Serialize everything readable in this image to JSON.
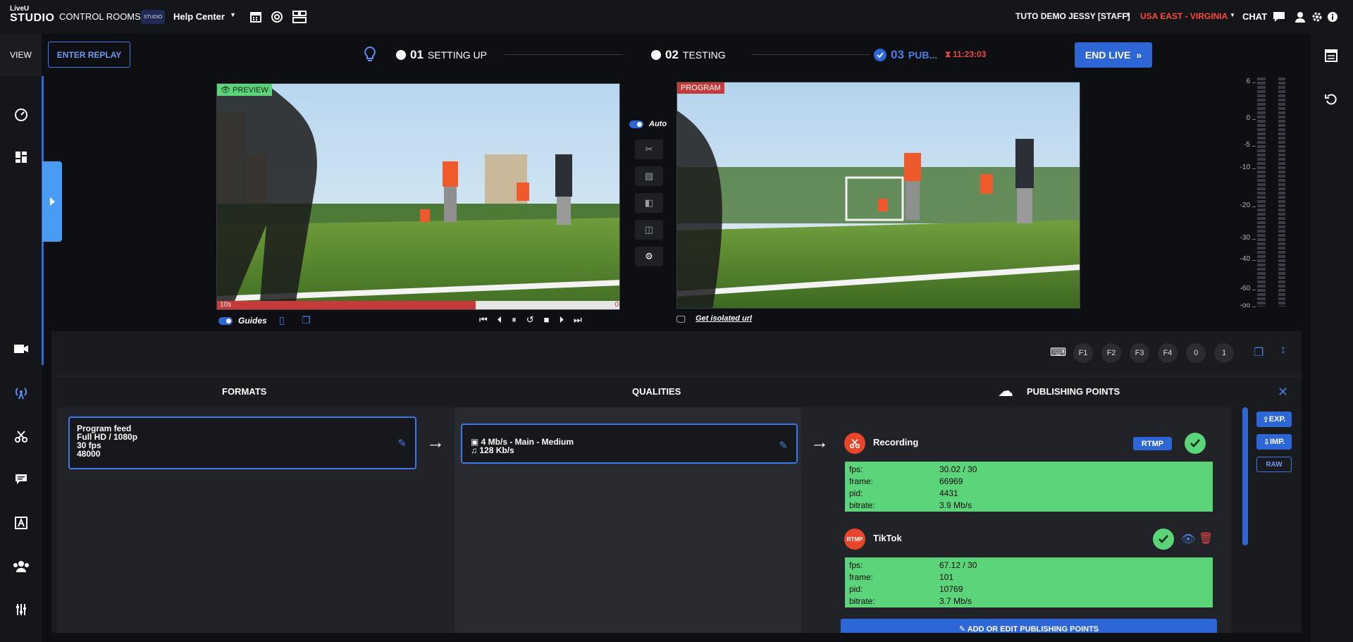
{
  "topbar": {
    "logo_line1": "LiveU",
    "logo_line2": "STUDIO",
    "control_rooms": "CONTROL ROOMS",
    "help_thumb": "STUDIO",
    "help_center": "Help Center",
    "user": "TUTO DEMO JESSY [STAFF]",
    "region": "USA EAST - VIRGINIA",
    "chat": "CHAT"
  },
  "sidebar": {
    "view_label": "VIEW"
  },
  "header": {
    "enter_replay": "ENTER REPLAY",
    "steps": [
      {
        "num": "01",
        "label": "SETTING UP"
      },
      {
        "num": "02",
        "label": "TESTING"
      },
      {
        "num": "03",
        "label": "PUB..."
      }
    ],
    "timer": "11:23:03",
    "end_live": "END LIVE"
  },
  "preview": {
    "label": "PREVIEW",
    "replay_time": "10s",
    "replay_end": "0",
    "replay_progress": 0.64,
    "guides_label": "Guides"
  },
  "program": {
    "label": "PROGRAM",
    "isolated_url": "Get isolated url"
  },
  "auto_label": "Auto",
  "vumeter": {
    "ticks": [
      "6",
      "0",
      "-5",
      "-10",
      "-20",
      "-30",
      "-40",
      "-60",
      "-oo"
    ]
  },
  "fkeys": [
    "F1",
    "F2",
    "F3",
    "F4",
    "0",
    "1"
  ],
  "formats": {
    "title": "FORMATS",
    "items": [
      {
        "line1": "Program feed",
        "line2": "Full HD / 1080p",
        "line3": "30 fps",
        "line4": "48000"
      }
    ]
  },
  "qualities": {
    "title": "QUALITIES",
    "items": [
      {
        "video": "4 Mb/s  -  Main  -  Medium",
        "audio": "128 Kb/s"
      }
    ]
  },
  "publishing": {
    "title": "PUBLISHING POINTS",
    "points": [
      {
        "name": "Recording",
        "protocol": "RTMP",
        "stats": [
          {
            "k": "fps:",
            "v": "30.02 / 30"
          },
          {
            "k": "frame:",
            "v": "66969"
          },
          {
            "k": "pid:",
            "v": "4431"
          },
          {
            "k": "bitrate:",
            "v": "3.9 Mb/s"
          }
        ]
      },
      {
        "name": "TikTok",
        "badge": "RTMP",
        "stats": [
          {
            "k": "fps:",
            "v": "67.12 / 30"
          },
          {
            "k": "frame:",
            "v": "101"
          },
          {
            "k": "pid:",
            "v": "10769"
          },
          {
            "k": "bitrate:",
            "v": "3.7 Mb/s"
          }
        ]
      }
    ],
    "add_button": "ADD OR EDIT PUBLISHING POINTS"
  },
  "side_actions": {
    "exp": "EXP.",
    "imp": "IMP.",
    "raw": "RAW"
  },
  "colors": {
    "accent": "#2f66d6",
    "region": "#ff4a3a",
    "ok": "#5cd47a",
    "timer": "#e94848"
  }
}
